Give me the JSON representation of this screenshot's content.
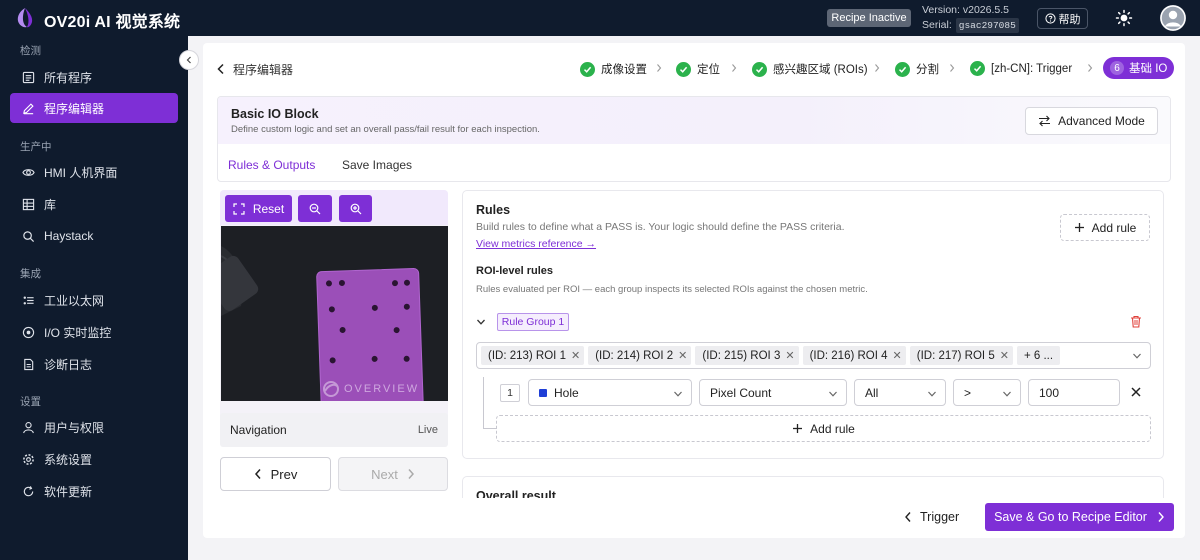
{
  "app": {
    "title": "OV20i AI 视觉系统",
    "recipe_status": "Recipe Inactive",
    "version": "Version: v2026.5.5",
    "serial_label": "Serial:",
    "serial": "gsac297085",
    "help_label": "帮助",
    "icons": {
      "theme": "sun-icon",
      "help": "question-circle-icon",
      "user": "user-avatar-icon"
    }
  },
  "sidebar": {
    "sections": [
      {
        "label": "检测",
        "items": [
          {
            "label": "所有程序",
            "icon": "list-icon"
          },
          {
            "label": "程序编辑器",
            "icon": "edit-icon",
            "active": true
          }
        ]
      },
      {
        "label": "生产中",
        "items": [
          {
            "label": "HMI 人机界面",
            "icon": "eye-icon"
          },
          {
            "label": "库",
            "icon": "grid-icon"
          },
          {
            "label": "Haystack",
            "icon": "search-icon"
          }
        ]
      },
      {
        "label": "集成",
        "items": [
          {
            "label": "工业以太网",
            "icon": "network-icon"
          },
          {
            "label": "I/O 实时监控",
            "icon": "io-icon"
          },
          {
            "label": "诊断日志",
            "icon": "log-icon"
          }
        ]
      },
      {
        "label": "设置",
        "items": [
          {
            "label": "用户与权限",
            "icon": "user-icon"
          },
          {
            "label": "系统设置",
            "icon": "gear-icon"
          },
          {
            "label": "软件更新",
            "icon": "refresh-icon"
          }
        ]
      }
    ]
  },
  "header": {
    "page_title": "程序编辑器",
    "steps": [
      {
        "label": "成像设置",
        "status": "done"
      },
      {
        "label": "定位",
        "status": "done"
      },
      {
        "label": "感兴趣区域 (ROIs)",
        "status": "done"
      },
      {
        "label": "分割",
        "status": "done"
      },
      {
        "label": "[zh-CN]: Trigger",
        "status": "done"
      },
      {
        "label": "基础 IO",
        "number": "6",
        "status": "current"
      }
    ]
  },
  "block": {
    "title": "Basic IO Block",
    "description": "Define custom logic and set an overall pass/fail result for each inspection.",
    "advanced_button": "Advanced Mode",
    "tabs": [
      {
        "label": "Rules & Outputs",
        "active": true
      },
      {
        "label": "Save Images",
        "active": false
      }
    ]
  },
  "image_panel": {
    "reset_label": "Reset",
    "watermark": "OVERVIEW",
    "navigation_label": "Navigation",
    "live_label": "Live",
    "prev_label": "Prev",
    "next_label": "Next"
  },
  "rules": {
    "title": "Rules",
    "description": "Build rules to define what a PASS is. Your logic should define the PASS criteria.",
    "link": "View metrics reference →",
    "add_rule_label": "Add rule",
    "roi_title": "ROI-level rules",
    "roi_description": "Rules evaluated per ROI — each group inspects its selected ROIs against the chosen metric.",
    "group_label": "Rule Group 1",
    "roi_chips": [
      "(ID: 213) ROI 1",
      "(ID: 214) ROI 2",
      "(ID: 215) ROI 3",
      "(ID: 216) ROI 4",
      "(ID: 217) ROI 5"
    ],
    "roi_more": "+ 6 ...",
    "condition": {
      "index": "1",
      "class": "Hole",
      "class_color": "#1f3fd6",
      "metric": "Pixel Count",
      "scope": "All",
      "operator": ">",
      "value": "100"
    },
    "inner_add_rule": "Add rule"
  },
  "overall": {
    "title": "Overall result"
  },
  "footer": {
    "trigger_label": "Trigger",
    "save_label": "Save & Go to Recipe Editor"
  },
  "colors": {
    "accent": "#7e2fd6",
    "sidebar_bg": "#0f1b2d",
    "success": "#2bb24c"
  }
}
